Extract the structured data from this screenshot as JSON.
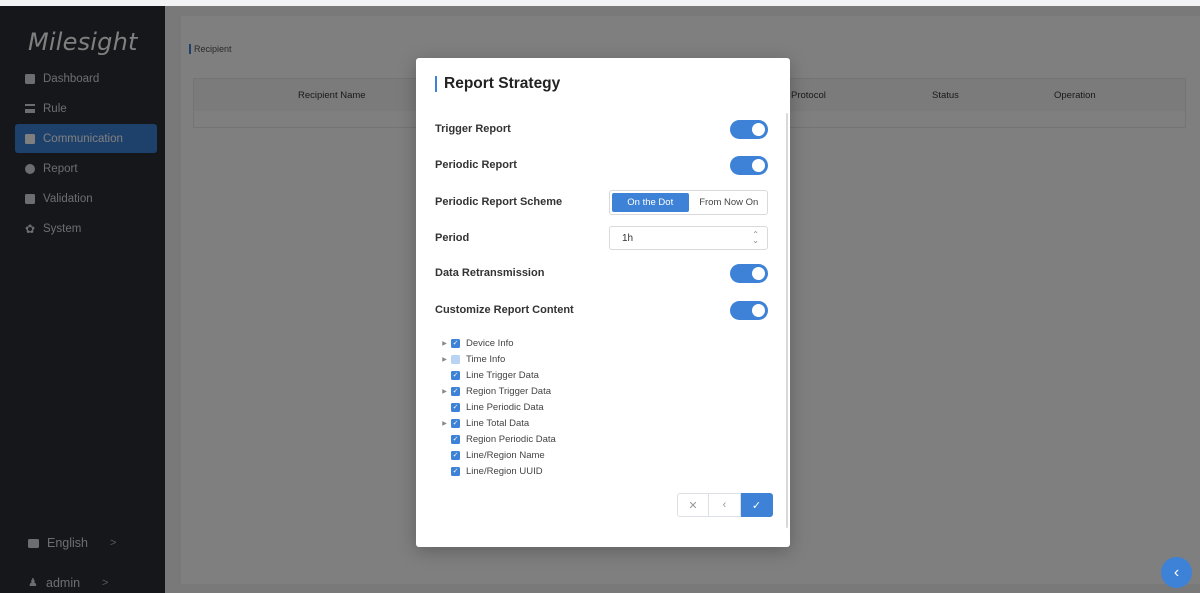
{
  "app": {
    "logo": "Milesight"
  },
  "sidebar": {
    "items": [
      {
        "label": "Dashboard",
        "icon": "dashboard-icon"
      },
      {
        "label": "Rule",
        "icon": "rule-icon"
      },
      {
        "label": "Communication",
        "icon": "communication-icon",
        "active": true
      },
      {
        "label": "Report",
        "icon": "report-icon"
      },
      {
        "label": "Validation",
        "icon": "validation-icon"
      },
      {
        "label": "System",
        "icon": "gear-icon"
      }
    ],
    "language": "English",
    "user": "admin",
    "chevron": ">"
  },
  "main": {
    "breadcrumb": "Recipient",
    "table": {
      "headers": [
        "Recipient Name",
        "Protocol",
        "Status",
        "Operation"
      ]
    }
  },
  "modal": {
    "title": "Report Strategy",
    "rows": {
      "trigger_report": {
        "label": "Trigger Report",
        "on": true
      },
      "periodic_report": {
        "label": "Periodic Report",
        "on": true
      },
      "scheme": {
        "label": "Periodic Report Scheme",
        "options": [
          "On the Dot",
          "From Now On"
        ],
        "selected": "On the Dot"
      },
      "period": {
        "label": "Period",
        "value": "1h"
      },
      "data_retransmission": {
        "label": "Data Retransmission",
        "on": true
      },
      "customize_content": {
        "label": "Customize Report Content",
        "on": true
      }
    },
    "tree": [
      {
        "label": "Device Info",
        "expandable": true,
        "state": "checked"
      },
      {
        "label": "Time Info",
        "expandable": true,
        "state": "partial"
      },
      {
        "label": "Line Trigger Data",
        "expandable": false,
        "state": "checked"
      },
      {
        "label": "Region Trigger Data",
        "expandable": true,
        "state": "checked"
      },
      {
        "label": "Line Periodic Data",
        "expandable": false,
        "state": "checked"
      },
      {
        "label": "Line Total Data",
        "expandable": true,
        "state": "checked"
      },
      {
        "label": "Region Periodic Data",
        "expandable": false,
        "state": "checked"
      },
      {
        "label": "Line/Region Name",
        "expandable": false,
        "state": "checked"
      },
      {
        "label": "Line/Region UUID",
        "expandable": false,
        "state": "checked"
      }
    ],
    "actions": {
      "cancel": "✕",
      "back": "‹",
      "confirm": "✓"
    }
  },
  "colors": {
    "accent": "#3d82d6",
    "sidebar_bg": "#2b2f36"
  }
}
